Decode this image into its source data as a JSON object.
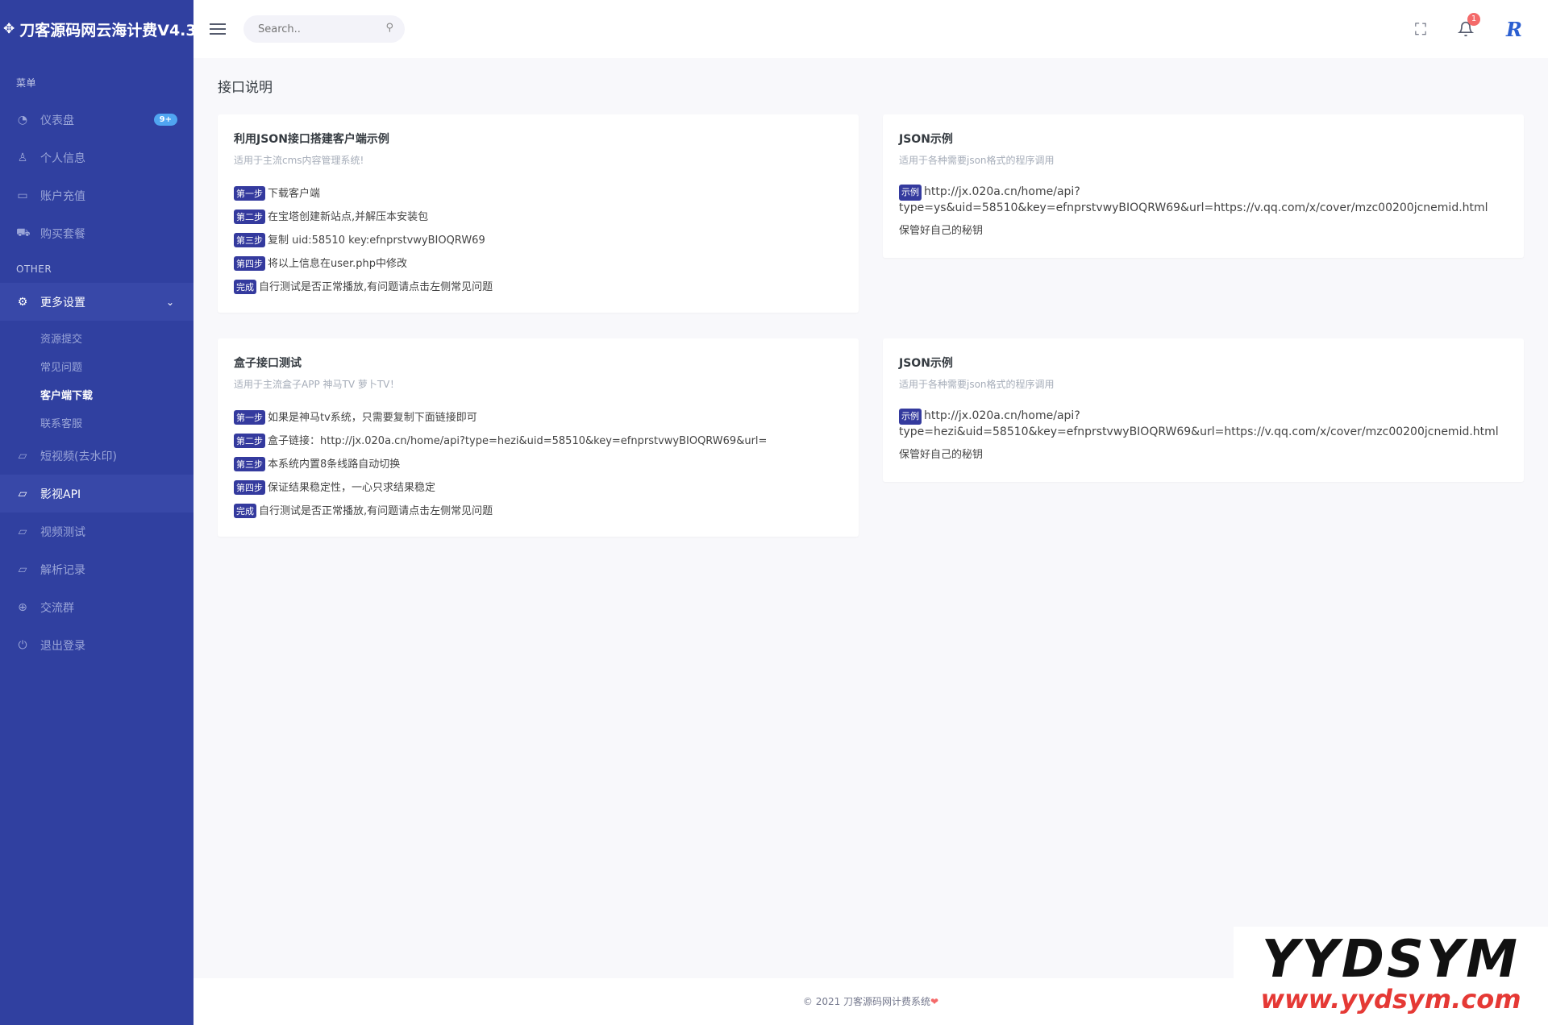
{
  "brand": {
    "title": "刀客源码网云海计费V4.3"
  },
  "sidebar": {
    "menu_title": "菜单",
    "other_title": "OTHER",
    "items_top": [
      {
        "label": "仪表盘",
        "badge": "9+"
      },
      {
        "label": "个人信息"
      },
      {
        "label": "账户充值"
      },
      {
        "label": "购买套餐"
      }
    ],
    "settings": {
      "label": "更多设置"
    },
    "sub_items": [
      {
        "label": "资源提交"
      },
      {
        "label": "常见问题"
      },
      {
        "label": "客户端下载"
      },
      {
        "label": "联系客服"
      }
    ],
    "items_bottom": [
      {
        "label": "短视频(去水印)"
      },
      {
        "label": "影视API"
      },
      {
        "label": "视频测试"
      },
      {
        "label": "解析记录"
      },
      {
        "label": "交流群"
      },
      {
        "label": "退出登录"
      }
    ]
  },
  "header": {
    "search_placeholder": "Search..",
    "notification_count": "1",
    "avatar_text": "R"
  },
  "page": {
    "title": "接口说明"
  },
  "cards": {
    "json_client": {
      "title": "利用JSON接口搭建客户端示例",
      "subtitle": "适用于主流cms内容管理系统!",
      "steps": [
        {
          "tag": "第一步",
          "text": "下载客户端"
        },
        {
          "tag": "第二步",
          "text": "在宝塔创建新站点,并解压本安装包"
        },
        {
          "tag": "第三步",
          "text": "复制 uid:58510 key:efnprstvwyBIOQRW69"
        },
        {
          "tag": "第四步",
          "text": "将以上信息在user.php中修改"
        },
        {
          "tag": "完成",
          "text": "自行测试是否正常播放,有问题请点击左侧常见问题"
        }
      ]
    },
    "json_example_1": {
      "title": "JSON示例",
      "subtitle": "适用于各种需要json格式的程序调用",
      "tag": "示例",
      "url_1": "http://jx.020a.cn/home/api?",
      "url_2": "type=ys&uid=58510&key=efnprstvwyBIOQRW69&url=https://v.qq.com/x/cover/mzc00200jcnemid.html",
      "note": "保管好自己的秘钥"
    },
    "box_test": {
      "title": "盒子接口测试",
      "subtitle": "适用于主流盒子APP 神马TV 萝卜TV！",
      "steps": [
        {
          "tag": "第一步",
          "text": "如果是神马tv系统，只需要复制下面链接即可"
        },
        {
          "tag": "第二步",
          "text": "盒子链接：http://jx.020a.cn/home/api?type=hezi&uid=58510&key=efnprstvwyBIOQRW69&url="
        },
        {
          "tag": "第三步",
          "text": "本系统内置8条线路自动切换"
        },
        {
          "tag": "第四步",
          "text": "保证结果稳定性，一心只求结果稳定"
        },
        {
          "tag": "完成",
          "text": "自行测试是否正常播放,有问题请点击左侧常见问题"
        }
      ]
    },
    "json_example_2": {
      "title": "JSON示例",
      "subtitle": "适用于各种需要json格式的程序调用",
      "tag": "示例",
      "url_1": "http://jx.020a.cn/home/api?",
      "url_2": "type=hezi&uid=58510&key=efnprstvwyBIOQRW69&url=https://v.qq.com/x/cover/mzc00200jcnemid.html",
      "note": "保管好自己的秘钥"
    }
  },
  "footer": {
    "text": "© 2021 刀客源码网计费系统",
    "heart": "❤"
  },
  "watermark": {
    "main": "YYDSYM",
    "url": "www.yydsym.com"
  }
}
